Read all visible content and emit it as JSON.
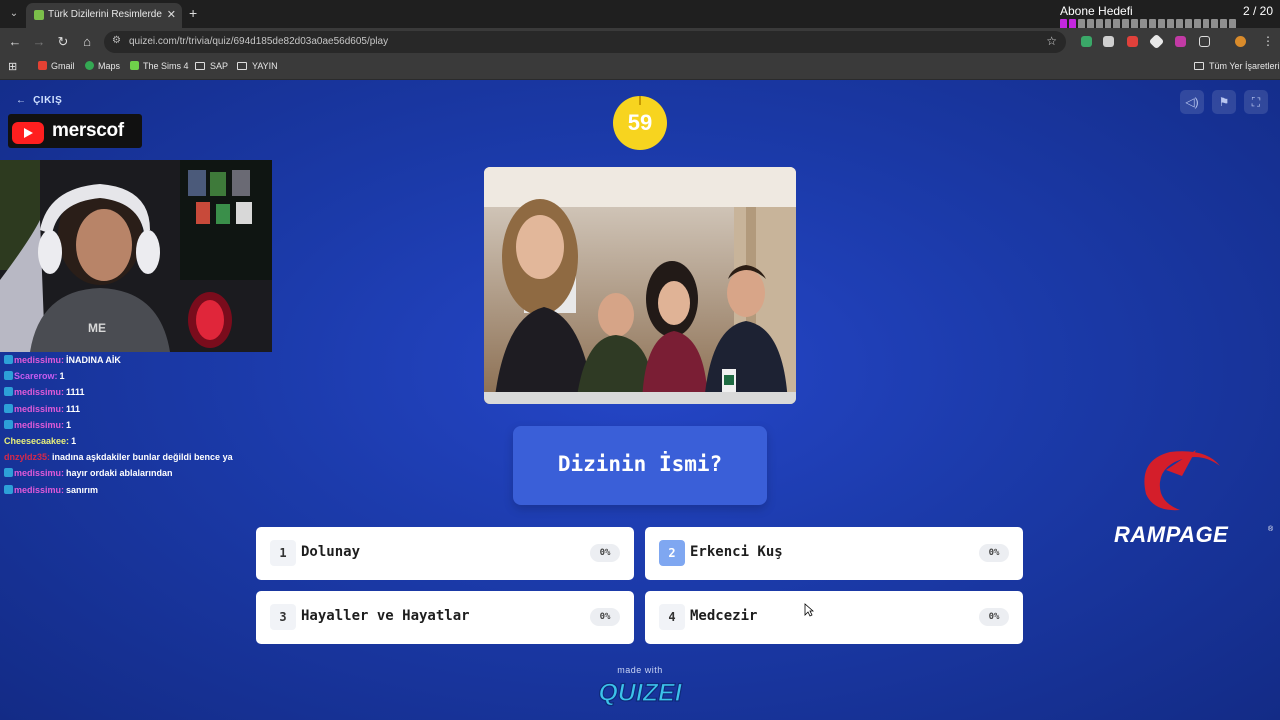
{
  "browser": {
    "tab_title": "Türk Dizilerini Resimlerden Tahmin",
    "url": "quizei.com/tr/trivia/quiz/694d185de82d03a0ae56d605/play",
    "bookmarks": [
      "Gmail",
      "Maps",
      "The Sims 4",
      "SAP",
      "YAYIN"
    ],
    "all_bookmarks": "Tüm Yer İşaretleri"
  },
  "overlay": {
    "goal_title": "Abone Hedefi",
    "goal_count": "2 / 20",
    "goal_progress": {
      "current": 2,
      "total": 20
    },
    "channel_name": "merscof",
    "chat": [
      {
        "user": "medissimu:",
        "message": "İNADINA AİK",
        "color": "#e05ad8"
      },
      {
        "user": "Scarerow:",
        "message": "1",
        "color": "#c65cf0"
      },
      {
        "user": "medissimu:",
        "message": "1111",
        "color": "#e05ad8"
      },
      {
        "user": "medissimu:",
        "message": "111",
        "color": "#e05ad8"
      },
      {
        "user": "medissimu:",
        "message": "1",
        "color": "#e05ad8"
      },
      {
        "user": "Cheesecaakee:",
        "message": "1",
        "color": "#e8f07a"
      },
      {
        "user": "dnzyldz35:",
        "message": "inadına aşkdakiler bunlar değildi bence ya",
        "color": "#d6294a"
      },
      {
        "user": "medissimu:",
        "message": "hayır ordaki ablalarından",
        "color": "#e05ad8"
      },
      {
        "user": "medissimu:",
        "message": "sanırım",
        "color": "#e05ad8"
      }
    ],
    "sponsor": "RAMPAGE",
    "sponsor_mark": "®"
  },
  "quiz": {
    "exit_label": "ÇIKIŞ",
    "timer": "59",
    "question": "Dizinin İsmi?",
    "answers": [
      {
        "number": "1",
        "text": "Dolunay",
        "percent": "0%"
      },
      {
        "number": "2",
        "text": "Erkenci Kuş",
        "percent": "0%"
      },
      {
        "number": "3",
        "text": "Hayaller ve Hayatlar",
        "percent": "0%"
      },
      {
        "number": "4",
        "text": "Medcezir",
        "percent": "0%"
      }
    ],
    "made_with": "made with",
    "brand": "QUIZEI"
  },
  "colors": {
    "page_bg": "#1b3aa9",
    "timer": "#f7d41f",
    "question_card": "#3a5fd8",
    "selected_number": "#7fa7f1",
    "sponsor_red": "#d41e2a"
  },
  "icons": [
    "back-arrow-icon",
    "volume-icon",
    "flag-icon",
    "fullscreen-icon",
    "youtube-icon",
    "star-icon",
    "cursor-icon"
  ]
}
